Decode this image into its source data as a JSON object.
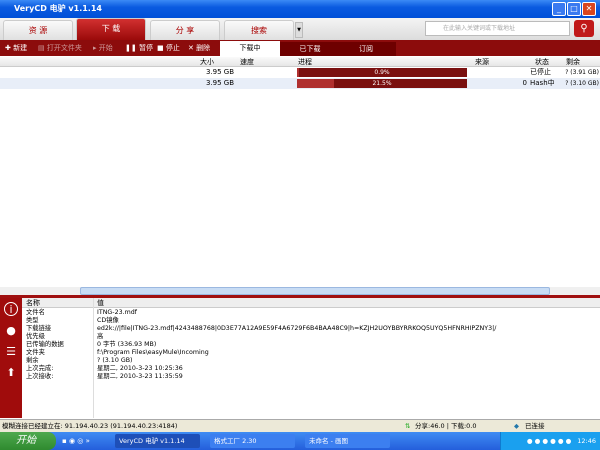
{
  "window": {
    "title": "VeryCD 电驴 v1.1.14",
    "min": "_",
    "max": "□",
    "close": "✕"
  },
  "main_tabs": [
    {
      "label": "资 源"
    },
    {
      "label": "下 载"
    },
    {
      "label": "分 享"
    },
    {
      "label": "搜索"
    }
  ],
  "search": {
    "placeholder": "在此输入关键词或下载地址"
  },
  "toolbar": {
    "new": "✚ 新建",
    "open_folder": "▤ 打开文件夹",
    "start": "▸ 开始",
    "pause": "❚❚ 暂停",
    "stop": "■ 停止",
    "delete": "✕ 删除"
  },
  "sub_tabs": [
    {
      "label": "下载中"
    },
    {
      "label": "已下载"
    },
    {
      "label": "订阅"
    }
  ],
  "columns": {
    "size": "大小",
    "speed": "速度",
    "progress": "进程",
    "source": "来源",
    "status": "状态",
    "remaining": "剩余"
  },
  "downloads": [
    {
      "size": "3.95 GB",
      "speed": "",
      "progress_label": "0.9%",
      "progress": 0.9,
      "source": "",
      "status": "已停止",
      "remaining": "? (3.91 GB)"
    },
    {
      "size": "3.95 GB",
      "speed": "",
      "progress_label": "21.5%",
      "progress": 21.5,
      "source": "0",
      "status": "Hash中",
      "remaining": "? (3.10 GB)"
    }
  ],
  "details": {
    "header_name": "名称",
    "header_value": "值",
    "rows": [
      {
        "name": "文件名",
        "value": "ITNG-23.mdf"
      },
      {
        "name": "类型",
        "value": "CD镜像"
      },
      {
        "name": "下载链接",
        "value": "ed2k://|file|ITNG-23.mdf|4243488768|0D3E77A12A9E59F4A6729F6B4BAA48C9|h=KZJH2UOYBBYRRKOQ5UYQ5HFNRHIPZNY3|/"
      },
      {
        "name": "优先级",
        "value": "高"
      },
      {
        "name": "已传输的数据",
        "value": "0 字节 (336.93 MB)"
      },
      {
        "name": "文件夹",
        "value": "f:\\Program Files\\easyMule\\Incoming"
      },
      {
        "name": "剩余",
        "value": "? (3.10 GB)"
      },
      {
        "name": "上次完成:",
        "value": "星期二, 2010-3-23 10:25:36"
      },
      {
        "name": "上次接收:",
        "value": "星期二, 2010-3-23 11:35:59"
      }
    ]
  },
  "statusbar": {
    "message": "模糊连接已经建立在: 91.194.40.23 (91.194.40.23:4184)",
    "transfer": "分享:46.0 | 下载:0.0",
    "connection": "已连接"
  },
  "taskbar": {
    "start": "开始",
    "tasks": [
      {
        "label": "VeryCD 电驴 v1.1.14"
      },
      {
        "label": "格式工厂 2.30"
      },
      {
        "label": "未命名 - 画图"
      }
    ],
    "clock": "12:46"
  }
}
